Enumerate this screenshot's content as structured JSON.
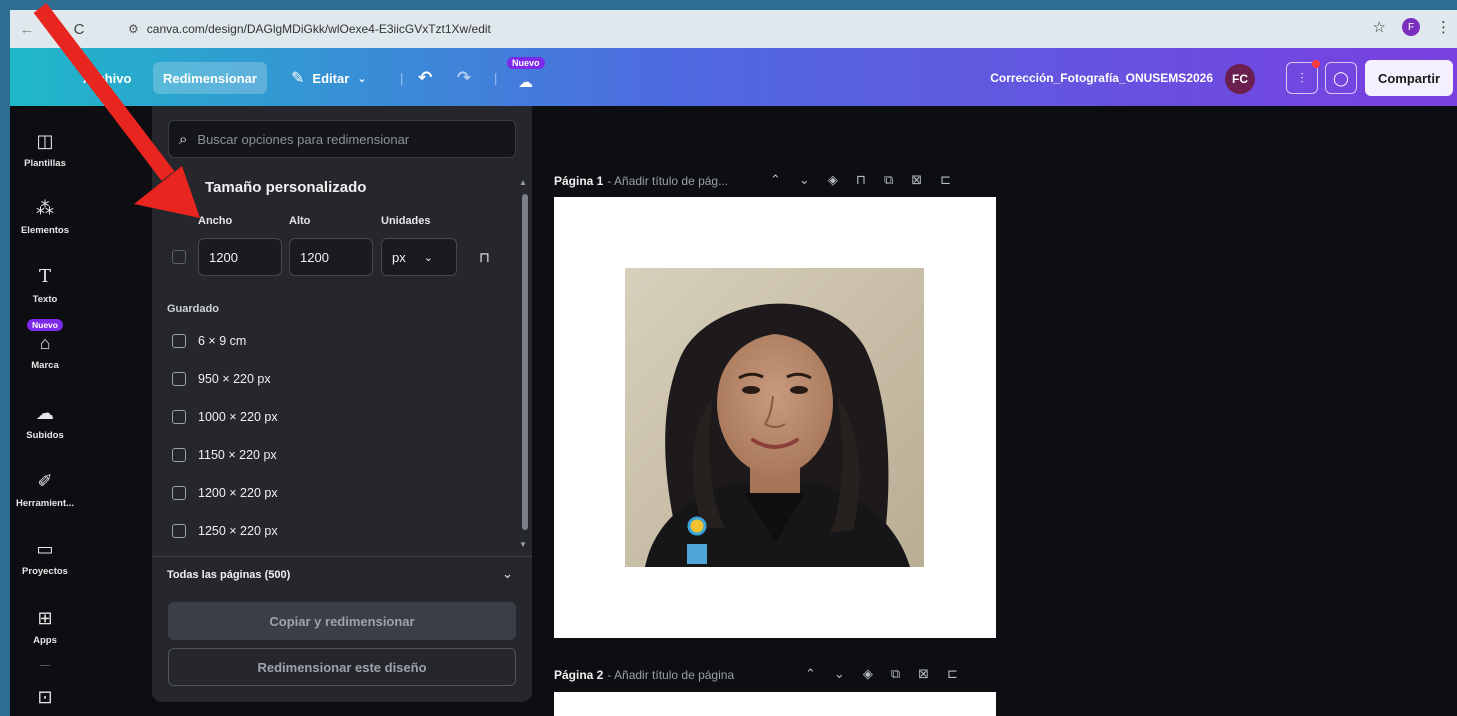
{
  "browser": {
    "url": "canva.com/design/DAGlgMDiGkk/wlOexe4-E3iicGVxTzt1Xw/edit",
    "profile_initial": "F"
  },
  "header": {
    "menu_file": "Archivo",
    "menu_resize": "Redimensionar",
    "menu_edit": "Editar",
    "nuevo_badge": "Nuevo",
    "design_title": "Corrección_Fotografía_ONUSEMS2026",
    "avatar_initials": "FC",
    "share_label": "Compartir"
  },
  "sidebar": {
    "items": [
      {
        "label": "Plantillas",
        "icon": "templates-icon"
      },
      {
        "label": "Elementos",
        "icon": "elements-icon"
      },
      {
        "label": "Texto",
        "icon": "text-icon"
      },
      {
        "label": "Marca",
        "icon": "brand-icon",
        "badge": "Nuevo"
      },
      {
        "label": "Subidos",
        "icon": "upload-icon"
      },
      {
        "label": "Herramient...",
        "icon": "tools-icon"
      },
      {
        "label": "Proyectos",
        "icon": "folder-icon"
      },
      {
        "label": "Apps",
        "icon": "apps-icon"
      }
    ]
  },
  "resize_panel": {
    "search_placeholder": "Buscar opciones para redimensionar",
    "custom_size_title": "Tamaño personalizado",
    "width_label": "Ancho",
    "height_label": "Alto",
    "units_label": "Unidades",
    "width_value": "1200",
    "height_value": "1200",
    "units_value": "px",
    "saved_label": "Guardado",
    "saved_items": [
      "6 × 9 cm",
      "950 × 220 px",
      "1000 × 220 px",
      "1150 × 220 px",
      "1200 × 220 px",
      "1250 × 220 px"
    ],
    "all_pages_label": "Todas las páginas (500)",
    "copy_resize_label": "Copiar y redimensionar",
    "resize_design_label": "Redimensionar este diseño"
  },
  "pages": [
    {
      "label": "Página 1",
      "subtitle": "- Añadir título de pág..."
    },
    {
      "label": "Página 2",
      "subtitle": "- Añadir título de página"
    }
  ],
  "colors": {
    "annotation_arrow": "#e8251f",
    "accent_purple": "#7d2ae8"
  }
}
